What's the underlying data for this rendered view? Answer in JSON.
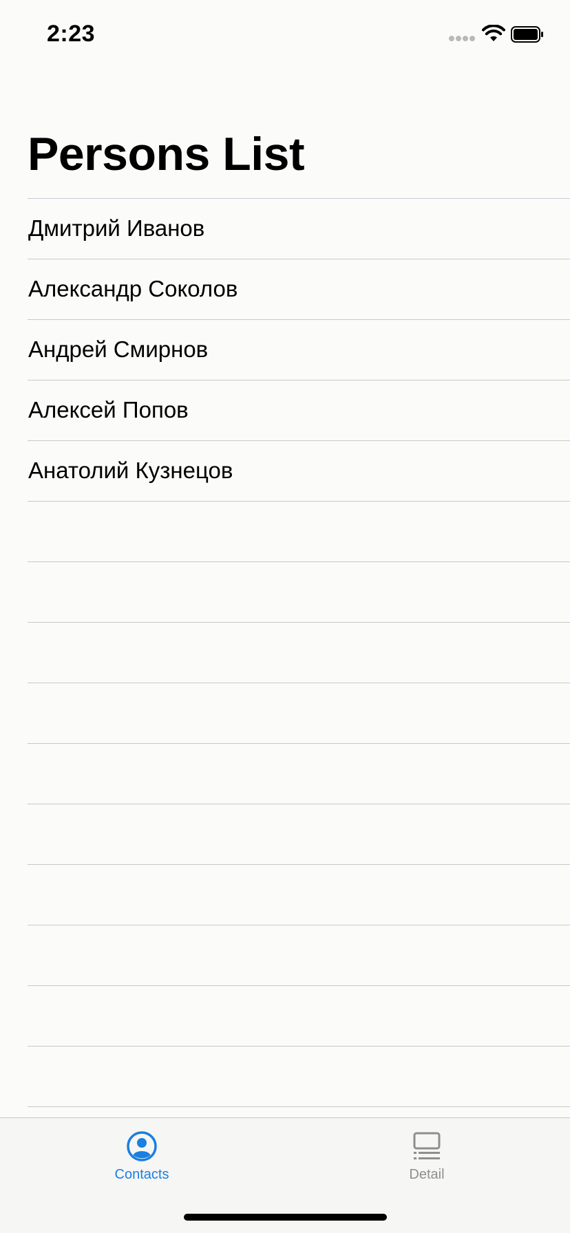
{
  "status_bar": {
    "time": "2:23"
  },
  "navigation": {
    "title": "Persons List"
  },
  "persons": [
    "Дмитрий Иванов",
    "Александр Соколов",
    "Андрей Смирнов",
    "Алексей Попов",
    "Анатолий Кузнецов"
  ],
  "tab_bar": {
    "tabs": [
      {
        "label": "Contacts",
        "icon": "person-circle-icon",
        "selected": true
      },
      {
        "label": "Detail",
        "icon": "list-detail-icon",
        "selected": false
      }
    ]
  },
  "colors": {
    "accent": "#1a7fe0",
    "inactive": "#8e8e8e",
    "background": "#fbfbf9"
  }
}
